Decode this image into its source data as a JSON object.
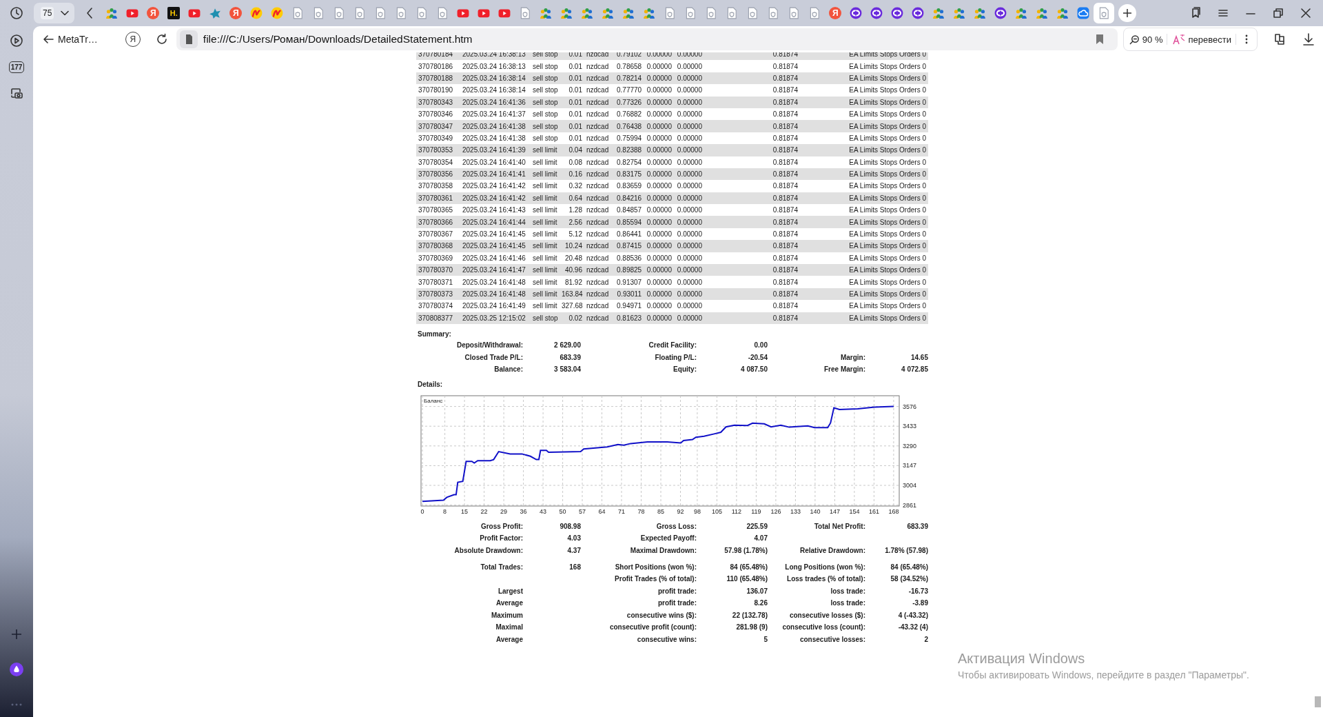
{
  "sidebar": {
    "badge": "177"
  },
  "tab_strip": {
    "tab_count": "75",
    "tabs": [
      {
        "kind": "people",
        "selected": false
      },
      {
        "kind": "video",
        "selected": false
      },
      {
        "kind": "glyph",
        "glyph": "Я",
        "selected": false
      },
      {
        "kind": "glyph_dark",
        "glyph": "H.",
        "selected": false
      },
      {
        "kind": "video",
        "selected": false
      },
      {
        "kind": "bird",
        "selected": false
      },
      {
        "kind": "glyph",
        "glyph": "Я",
        "selected": false
      },
      {
        "kind": "swirl",
        "selected": false
      },
      {
        "kind": "swirl",
        "selected": false
      },
      {
        "kind": "page",
        "selected": false
      },
      {
        "kind": "page",
        "selected": false
      },
      {
        "kind": "page",
        "selected": false
      },
      {
        "kind": "page",
        "selected": false
      },
      {
        "kind": "page",
        "selected": false
      },
      {
        "kind": "page",
        "selected": false
      },
      {
        "kind": "page",
        "selected": false
      },
      {
        "kind": "page",
        "selected": false
      },
      {
        "kind": "video",
        "selected": false
      },
      {
        "kind": "video",
        "selected": false
      },
      {
        "kind": "video",
        "selected": false
      },
      {
        "kind": "page",
        "selected": false
      },
      {
        "kind": "people",
        "selected": false
      },
      {
        "kind": "people",
        "selected": false
      },
      {
        "kind": "people",
        "selected": false
      },
      {
        "kind": "people",
        "selected": false
      },
      {
        "kind": "people",
        "selected": false
      },
      {
        "kind": "people",
        "selected": false
      },
      {
        "kind": "page",
        "selected": false
      },
      {
        "kind": "page",
        "selected": false
      },
      {
        "kind": "page",
        "selected": false
      },
      {
        "kind": "page",
        "selected": false
      },
      {
        "kind": "page",
        "selected": false
      },
      {
        "kind": "page",
        "selected": false
      },
      {
        "kind": "page",
        "selected": false
      },
      {
        "kind": "page",
        "selected": false
      },
      {
        "kind": "glyph",
        "glyph": "Я",
        "selected": false
      },
      {
        "kind": "ring",
        "selected": false
      },
      {
        "kind": "ring",
        "selected": false
      },
      {
        "kind": "ring",
        "selected": false
      },
      {
        "kind": "ring",
        "selected": false
      },
      {
        "kind": "people",
        "selected": false
      },
      {
        "kind": "people",
        "selected": false
      },
      {
        "kind": "people",
        "selected": false
      },
      {
        "kind": "ring",
        "selected": false
      },
      {
        "kind": "people",
        "selected": false
      },
      {
        "kind": "people",
        "selected": false
      },
      {
        "kind": "people",
        "selected": false
      },
      {
        "kind": "cloud",
        "selected": false
      },
      {
        "kind": "page",
        "selected": true
      }
    ]
  },
  "address_bar": {
    "back_label": "MetaTr…",
    "home_glyph": "Я",
    "url": "file:///C:/Users/Роман/Downloads/DetailedStatement.htm",
    "zoom": "90 %",
    "translate": "перевести"
  },
  "statement": {
    "orders": [
      [
        "370780184",
        "2025.03.24 16:38:13",
        "sell stop",
        "0.01",
        "nzdcad",
        "0.79102",
        "0.00000",
        "0.00000",
        "0.81874",
        "EA Limits Stops Orders 0"
      ],
      [
        "370780186",
        "2025.03.24 16:38:13",
        "sell stop",
        "0.01",
        "nzdcad",
        "0.78658",
        "0.00000",
        "0.00000",
        "0.81874",
        "EA Limits Stops Orders 0"
      ],
      [
        "370780188",
        "2025.03.24 16:38:14",
        "sell stop",
        "0.01",
        "nzdcad",
        "0.78214",
        "0.00000",
        "0.00000",
        "0.81874",
        "EA Limits Stops Orders 0"
      ],
      [
        "370780190",
        "2025.03.24 16:38:14",
        "sell stop",
        "0.01",
        "nzdcad",
        "0.77770",
        "0.00000",
        "0.00000",
        "0.81874",
        "EA Limits Stops Orders 0"
      ],
      [
        "370780343",
        "2025.03.24 16:41:36",
        "sell stop",
        "0.01",
        "nzdcad",
        "0.77326",
        "0.00000",
        "0.00000",
        "0.81874",
        "EA Limits Stops Orders 0"
      ],
      [
        "370780346",
        "2025.03.24 16:41:37",
        "sell stop",
        "0.01",
        "nzdcad",
        "0.76882",
        "0.00000",
        "0.00000",
        "0.81874",
        "EA Limits Stops Orders 0"
      ],
      [
        "370780347",
        "2025.03.24 16:41:38",
        "sell stop",
        "0.01",
        "nzdcad",
        "0.76438",
        "0.00000",
        "0.00000",
        "0.81874",
        "EA Limits Stops Orders 0"
      ],
      [
        "370780349",
        "2025.03.24 16:41:38",
        "sell stop",
        "0.01",
        "nzdcad",
        "0.75994",
        "0.00000",
        "0.00000",
        "0.81874",
        "EA Limits Stops Orders 0"
      ],
      [
        "370780353",
        "2025.03.24 16:41:39",
        "sell limit",
        "0.04",
        "nzdcad",
        "0.82388",
        "0.00000",
        "0.00000",
        "0.81874",
        "EA Limits Stops Orders 0"
      ],
      [
        "370780354",
        "2025.03.24 16:41:40",
        "sell limit",
        "0.08",
        "nzdcad",
        "0.82754",
        "0.00000",
        "0.00000",
        "0.81874",
        "EA Limits Stops Orders 0"
      ],
      [
        "370780356",
        "2025.03.24 16:41:41",
        "sell limit",
        "0.16",
        "nzdcad",
        "0.83175",
        "0.00000",
        "0.00000",
        "0.81874",
        "EA Limits Stops Orders 0"
      ],
      [
        "370780358",
        "2025.03.24 16:41:42",
        "sell limit",
        "0.32",
        "nzdcad",
        "0.83659",
        "0.00000",
        "0.00000",
        "0.81874",
        "EA Limits Stops Orders 0"
      ],
      [
        "370780361",
        "2025.03.24 16:41:42",
        "sell limit",
        "0.64",
        "nzdcad",
        "0.84216",
        "0.00000",
        "0.00000",
        "0.81874",
        "EA Limits Stops Orders 0"
      ],
      [
        "370780365",
        "2025.03.24 16:41:43",
        "sell limit",
        "1.28",
        "nzdcad",
        "0.84857",
        "0.00000",
        "0.00000",
        "0.81874",
        "EA Limits Stops Orders 0"
      ],
      [
        "370780366",
        "2025.03.24 16:41:44",
        "sell limit",
        "2.56",
        "nzdcad",
        "0.85594",
        "0.00000",
        "0.00000",
        "0.81874",
        "EA Limits Stops Orders 0"
      ],
      [
        "370780367",
        "2025.03.24 16:41:45",
        "sell limit",
        "5.12",
        "nzdcad",
        "0.86441",
        "0.00000",
        "0.00000",
        "0.81874",
        "EA Limits Stops Orders 0"
      ],
      [
        "370780368",
        "2025.03.24 16:41:45",
        "sell limit",
        "10.24",
        "nzdcad",
        "0.87415",
        "0.00000",
        "0.00000",
        "0.81874",
        "EA Limits Stops Orders 0"
      ],
      [
        "370780369",
        "2025.03.24 16:41:46",
        "sell limit",
        "20.48",
        "nzdcad",
        "0.88536",
        "0.00000",
        "0.00000",
        "0.81874",
        "EA Limits Stops Orders 0"
      ],
      [
        "370780370",
        "2025.03.24 16:41:47",
        "sell limit",
        "40.96",
        "nzdcad",
        "0.89825",
        "0.00000",
        "0.00000",
        "0.81874",
        "EA Limits Stops Orders 0"
      ],
      [
        "370780371",
        "2025.03.24 16:41:48",
        "sell limit",
        "81.92",
        "nzdcad",
        "0.91307",
        "0.00000",
        "0.00000",
        "0.81874",
        "EA Limits Stops Orders 0"
      ],
      [
        "370780373",
        "2025.03.24 16:41:48",
        "sell limit",
        "163.84",
        "nzdcad",
        "0.93011",
        "0.00000",
        "0.00000",
        "0.81874",
        "EA Limits Stops Orders 0"
      ],
      [
        "370780374",
        "2025.03.24 16:41:49",
        "sell limit",
        "327.68",
        "nzdcad",
        "0.94971",
        "0.00000",
        "0.00000",
        "0.81874",
        "EA Limits Stops Orders 0"
      ],
      [
        "370808377",
        "2025.03.25 12:15:02",
        "sell stop",
        "0.02",
        "nzdcad",
        "0.81623",
        "0.00000",
        "0.00000",
        "0.81874",
        "EA Limits Stops Orders 0"
      ]
    ],
    "summary": {
      "title": "Summary:",
      "rows": [
        [
          {
            "label": "Deposit/Withdrawal:",
            "value": "2 629.00"
          },
          {
            "label": "Credit Facility:",
            "value": "0.00"
          }
        ],
        [
          {
            "label": "Closed Trade P/L:",
            "value": "683.39"
          },
          {
            "label": "Floating P/L:",
            "value": "-20.54"
          },
          {
            "label": "Margin:",
            "value": "14.65"
          }
        ],
        [
          {
            "label": "Balance:",
            "value": "3 583.04"
          },
          {
            "label": "Equity:",
            "value": "4 087.50"
          },
          {
            "label": "Free Margin:",
            "value": "4 072.85"
          }
        ]
      ]
    },
    "details": {
      "title": "Details:",
      "chart_data": {
        "type": "line",
        "grid": true,
        "xlim": [
          -0.5,
          170
        ],
        "ylim": [
          2854,
          3654
        ],
        "xticks": [
          0,
          8,
          15,
          22,
          29,
          36,
          43,
          50,
          57,
          64,
          71,
          78,
          85,
          92,
          98,
          105,
          112,
          119,
          126,
          133,
          140,
          147,
          154,
          161,
          168
        ],
        "yticks": [
          2861,
          3004,
          3147,
          3290,
          3433,
          3576
        ],
        "x": [
          0,
          7.5,
          8.7,
          11.3,
          12,
          12.6,
          14.4,
          15.6,
          17.6,
          18.5,
          19.7,
          24.2,
          25.4,
          27.2,
          31.3,
          35.5,
          38.5,
          40.6,
          41.5,
          42.1,
          44.2,
          45,
          56.4,
          57.5,
          65.9,
          69.7,
          71.8,
          74.2,
          80.2,
          87.3,
          92.1,
          93.1,
          96.3,
          97.5,
          100.4,
          104,
          106.4,
          108.2,
          111.2,
          115.9,
          117.7,
          121.9,
          124.3,
          127.8,
          130.8,
          137.4,
          139.8,
          144.5,
          145.5,
          146.7,
          148.7,
          155.2,
          161.2,
          168
        ],
        "series": [
          {
            "name": "Баланс",
            "color": "#1010c8",
            "values": [
              2888,
              2897,
              2917,
              2936,
              2936,
              3026,
              3033,
              3178,
              3178,
              3166,
              3183,
              3183,
              3191,
              3249,
              3232,
              3232,
              3215,
              3191,
              3191,
              3258,
              3258,
              3244,
              3249,
              3268,
              3283,
              3300,
              3295,
              3307,
              3319,
              3319,
              3312,
              3329,
              3336,
              3353,
              3360,
              3377,
              3389,
              3428,
              3440,
              3438,
              3455,
              3450,
              3428,
              3440,
              3426,
              3435,
              3423,
              3423,
              3457,
              3566,
              3554,
              3559,
              3571,
              3576
            ]
          }
        ]
      }
    },
    "stats": [
      [
        [
          {
            "label": "Gross Profit:",
            "value": "908.98"
          },
          {
            "label": "Gross Loss:",
            "value": "225.59"
          },
          {
            "label": "Total Net Profit:",
            "value": "683.39"
          }
        ],
        [
          {
            "label": "Profit Factor:",
            "value": "4.03"
          },
          {
            "label": "Expected Payoff:",
            "value": "4.07"
          }
        ],
        [
          {
            "label": "Absolute Drawdown:",
            "value": "4.37"
          },
          {
            "label": "Maximal Drawdown:",
            "value": "57.98 (1.78%)"
          },
          {
            "label": "Relative Drawdown:",
            "value": "1.78% (57.98)"
          }
        ]
      ],
      [
        [
          {
            "label": "Total Trades:",
            "value": "168"
          },
          {
            "label": "Short Positions (won %):",
            "value": "84 (65.48%)"
          },
          {
            "label": "Long Positions (won %):",
            "value": "84 (65.48%)"
          }
        ],
        {
          "kind": "tail",
          "cells": [
            {
              "label": "Profit Trades (% of total):",
              "value": "110 (65.48%)"
            },
            {
              "label": "Loss trades (% of total):",
              "value": "58 (34.52%)"
            }
          ]
        },
        [
          {
            "label": "Largest"
          },
          {
            "label": "profit trade:",
            "value": "136.07"
          },
          {
            "label": "loss trade:",
            "value": "-16.73"
          }
        ],
        [
          {
            "label": "Average"
          },
          {
            "label": "profit trade:",
            "value": "8.26"
          },
          {
            "label": "loss trade:",
            "value": "-3.89"
          }
        ],
        [
          {
            "label": "Maximum"
          },
          {
            "label": "consecutive wins ($):",
            "value": "22 (132.78)"
          },
          {
            "label": "consecutive losses ($):",
            "value": "4 (-43.32)"
          }
        ],
        [
          {
            "label": "Maximal"
          },
          {
            "label": "consecutive profit (count):",
            "value": "281.98 (9)"
          },
          {
            "label": "consecutive loss (count):",
            "value": "-43.32 (4)"
          }
        ],
        [
          {
            "label": "Average"
          },
          {
            "label": "consecutive wins:",
            "value": "5"
          },
          {
            "label": "consecutive losses:",
            "value": "2"
          }
        ]
      ]
    ]
  },
  "os_notice": {
    "title": "Активация Windows",
    "text": "Чтобы активировать Windows, перейдите в раздел \"Параметры\"."
  }
}
